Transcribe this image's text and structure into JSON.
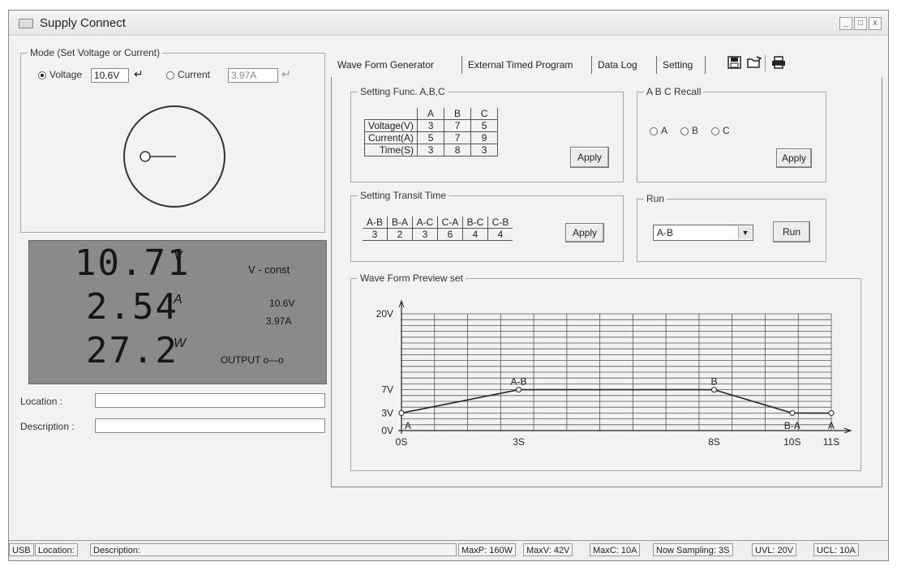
{
  "window": {
    "title": "Supply Connect",
    "min_label": "_",
    "max_label": "□",
    "close_label": "x"
  },
  "mode": {
    "group_label": "Mode (Set Voltage or Current)",
    "voltage_label": "Voltage",
    "voltage_value": "10.6V",
    "current_label": "Current",
    "current_value": "3.97A",
    "selected": "voltage"
  },
  "display": {
    "voltage": "10.71",
    "voltage_unit": "V",
    "current": "2.54",
    "current_unit": "A",
    "power": "27.2",
    "power_unit": "W",
    "mode_text": "V - const",
    "set_voltage": "10.6V",
    "set_current": "3.97A",
    "output_label": "OUTPUT o—o"
  },
  "info": {
    "location_label": "Location :",
    "location_value": "",
    "description_label": "Description :",
    "description_value": ""
  },
  "tabs": [
    {
      "label": "Wave Form Generator",
      "active": true
    },
    {
      "label": "External Timed Program",
      "active": false
    },
    {
      "label": "Data Log",
      "active": false
    },
    {
      "label": "Setting",
      "active": false
    }
  ],
  "toolbar_icons": [
    "save-icon",
    "open-folder-icon",
    "print-icon"
  ],
  "func_setting": {
    "group_label": "Setting Func. A,B,C",
    "columns": [
      "A",
      "B",
      "C"
    ],
    "rows": [
      {
        "label": "Voltage(V)",
        "values": [
          "3",
          "7",
          "5"
        ]
      },
      {
        "label": "Current(A)",
        "values": [
          "5",
          "7",
          "9"
        ]
      },
      {
        "label": "Time(S)",
        "values": [
          "3",
          "8",
          "3"
        ]
      }
    ],
    "apply_label": "Apply"
  },
  "recall": {
    "group_label": "A B C Recall",
    "options": [
      "A",
      "B",
      "C"
    ],
    "apply_label": "Apply"
  },
  "transit": {
    "group_label": "Setting Transit Time",
    "headers": [
      "A-B",
      "B-A",
      "A-C",
      "C-A",
      "B-C",
      "C-B"
    ],
    "values": [
      "3",
      "2",
      "3",
      "6",
      "4",
      "4"
    ],
    "apply_label": "Apply"
  },
  "run": {
    "group_label": "Run",
    "selected": "A-B",
    "run_label": "Run"
  },
  "preview": {
    "group_label": "Wave Form Preview set",
    "chart_data": {
      "type": "line",
      "title": "",
      "xlabel": "",
      "ylabel": "",
      "x": [
        0,
        3,
        8,
        10,
        11
      ],
      "y": [
        3,
        7,
        7,
        3,
        3
      ],
      "ylim": [
        0,
        20
      ],
      "xlim": [
        0,
        11
      ],
      "x_tick_labels": [
        "0S",
        "3S",
        "8S",
        "10S",
        "11S"
      ],
      "y_tick_labels": [
        "20V",
        "7V",
        "3V",
        "0V"
      ],
      "point_labels": [
        "A",
        "A-B",
        "B",
        "B-A",
        "A"
      ],
      "grid": true
    }
  },
  "status": [
    "USB",
    "Location:",
    "Description:",
    "MaxP: 160W",
    "MaxV: 42V",
    "MaxC: 10A",
    "Now Sampling: 3S",
    "UVL: 20V",
    "UCL: 10A"
  ]
}
